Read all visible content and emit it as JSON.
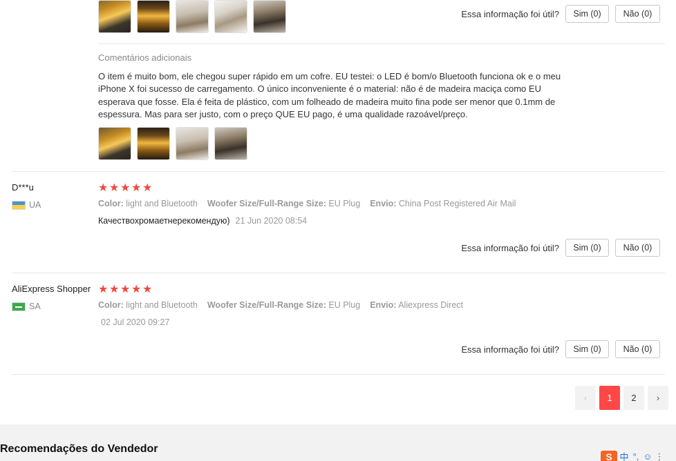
{
  "review1": {
    "helpful": {
      "question": "Essa informação foi útil?",
      "yes": "Sim (0)",
      "no": "Não (0)"
    },
    "additional": {
      "title": "Comentários adicionais",
      "text": "O item é muito bom, ele chegou super rápido em um cofre. EU testei: o LED é bom/o Bluetooth funciona ok e o meu iPhone X foi sucesso de carregamento. O único inconveniente é o material: não é de madeira maciça como EU esperava que fosse. Ela é feita de plástico, com um folheado de madeira muito fina pode ser menor que 0.1mm de espessura. Mas para ser justo, com o preço QUE EU pago, é uma qualidade razoável/preço."
    }
  },
  "review2": {
    "user": "D***u",
    "country": "UA",
    "stars": "★★★★★",
    "color_label": "Color:",
    "color_value": "light and Bluetooth",
    "woofer_label": "Woofer Size/Full-Range Size:",
    "woofer_value": "EU Plug",
    "shipping_label": "Envio:",
    "shipping_value": "China Post Registered Air Mail",
    "text": "Качествохромаетнерекомендую)",
    "date": "21 Jun 2020 08:54",
    "helpful": {
      "question": "Essa informação foi útil?",
      "yes": "Sim (0)",
      "no": "Não (0)"
    }
  },
  "review3": {
    "user": "AliExpress Shopper",
    "country": "SA",
    "stars": "★★★★★",
    "color_label": "Color:",
    "color_value": "light and Bluetooth",
    "woofer_label": "Woofer Size/Full-Range Size:",
    "woofer_value": "EU Plug",
    "shipping_label": "Envio:",
    "shipping_value": "Aliexpress Direct",
    "date": "02 Jul 2020 09:27",
    "helpful": {
      "question": "Essa informação foi útil?",
      "yes": "Sim (0)",
      "no": "Não (0)"
    }
  },
  "pagination": {
    "prev": "‹",
    "pages": [
      "1",
      "2"
    ],
    "current": "1",
    "next": "›"
  },
  "recommendations": {
    "title": "Recomendações do Vendedor"
  },
  "ime": {
    "logo": "S",
    "lang": "中"
  },
  "colors": {
    "star": "#f2483f",
    "active_page": "#ff4747"
  }
}
